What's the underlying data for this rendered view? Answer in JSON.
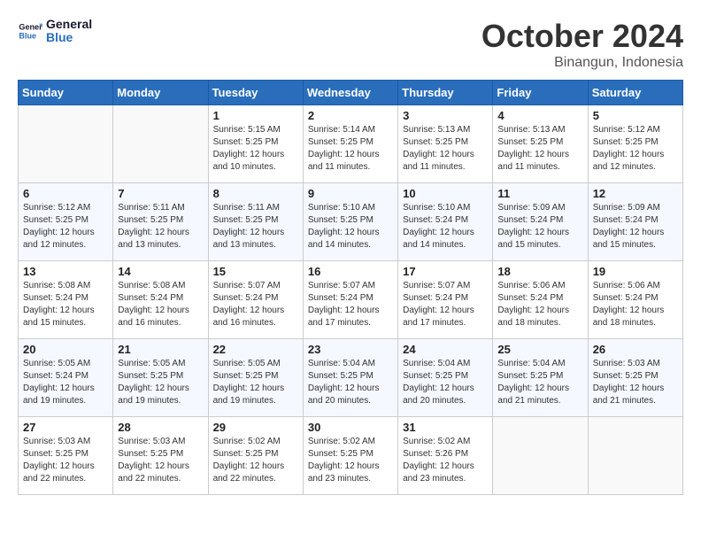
{
  "header": {
    "logo_general": "General",
    "logo_blue": "Blue",
    "month_title": "October 2024",
    "subtitle": "Binangun, Indonesia"
  },
  "days_of_week": [
    "Sunday",
    "Monday",
    "Tuesday",
    "Wednesday",
    "Thursday",
    "Friday",
    "Saturday"
  ],
  "weeks": [
    [
      {
        "day": "",
        "sunrise": "",
        "sunset": "",
        "daylight": "",
        "empty": true
      },
      {
        "day": "",
        "sunrise": "",
        "sunset": "",
        "daylight": "",
        "empty": true
      },
      {
        "day": "1",
        "sunrise": "Sunrise: 5:15 AM",
        "sunset": "Sunset: 5:25 PM",
        "daylight": "Daylight: 12 hours and 10 minutes.",
        "empty": false
      },
      {
        "day": "2",
        "sunrise": "Sunrise: 5:14 AM",
        "sunset": "Sunset: 5:25 PM",
        "daylight": "Daylight: 12 hours and 11 minutes.",
        "empty": false
      },
      {
        "day": "3",
        "sunrise": "Sunrise: 5:13 AM",
        "sunset": "Sunset: 5:25 PM",
        "daylight": "Daylight: 12 hours and 11 minutes.",
        "empty": false
      },
      {
        "day": "4",
        "sunrise": "Sunrise: 5:13 AM",
        "sunset": "Sunset: 5:25 PM",
        "daylight": "Daylight: 12 hours and 11 minutes.",
        "empty": false
      },
      {
        "day": "5",
        "sunrise": "Sunrise: 5:12 AM",
        "sunset": "Sunset: 5:25 PM",
        "daylight": "Daylight: 12 hours and 12 minutes.",
        "empty": false
      }
    ],
    [
      {
        "day": "6",
        "sunrise": "Sunrise: 5:12 AM",
        "sunset": "Sunset: 5:25 PM",
        "daylight": "Daylight: 12 hours and 12 minutes.",
        "empty": false
      },
      {
        "day": "7",
        "sunrise": "Sunrise: 5:11 AM",
        "sunset": "Sunset: 5:25 PM",
        "daylight": "Daylight: 12 hours and 13 minutes.",
        "empty": false
      },
      {
        "day": "8",
        "sunrise": "Sunrise: 5:11 AM",
        "sunset": "Sunset: 5:25 PM",
        "daylight": "Daylight: 12 hours and 13 minutes.",
        "empty": false
      },
      {
        "day": "9",
        "sunrise": "Sunrise: 5:10 AM",
        "sunset": "Sunset: 5:25 PM",
        "daylight": "Daylight: 12 hours and 14 minutes.",
        "empty": false
      },
      {
        "day": "10",
        "sunrise": "Sunrise: 5:10 AM",
        "sunset": "Sunset: 5:24 PM",
        "daylight": "Daylight: 12 hours and 14 minutes.",
        "empty": false
      },
      {
        "day": "11",
        "sunrise": "Sunrise: 5:09 AM",
        "sunset": "Sunset: 5:24 PM",
        "daylight": "Daylight: 12 hours and 15 minutes.",
        "empty": false
      },
      {
        "day": "12",
        "sunrise": "Sunrise: 5:09 AM",
        "sunset": "Sunset: 5:24 PM",
        "daylight": "Daylight: 12 hours and 15 minutes.",
        "empty": false
      }
    ],
    [
      {
        "day": "13",
        "sunrise": "Sunrise: 5:08 AM",
        "sunset": "Sunset: 5:24 PM",
        "daylight": "Daylight: 12 hours and 15 minutes.",
        "empty": false
      },
      {
        "day": "14",
        "sunrise": "Sunrise: 5:08 AM",
        "sunset": "Sunset: 5:24 PM",
        "daylight": "Daylight: 12 hours and 16 minutes.",
        "empty": false
      },
      {
        "day": "15",
        "sunrise": "Sunrise: 5:07 AM",
        "sunset": "Sunset: 5:24 PM",
        "daylight": "Daylight: 12 hours and 16 minutes.",
        "empty": false
      },
      {
        "day": "16",
        "sunrise": "Sunrise: 5:07 AM",
        "sunset": "Sunset: 5:24 PM",
        "daylight": "Daylight: 12 hours and 17 minutes.",
        "empty": false
      },
      {
        "day": "17",
        "sunrise": "Sunrise: 5:07 AM",
        "sunset": "Sunset: 5:24 PM",
        "daylight": "Daylight: 12 hours and 17 minutes.",
        "empty": false
      },
      {
        "day": "18",
        "sunrise": "Sunrise: 5:06 AM",
        "sunset": "Sunset: 5:24 PM",
        "daylight": "Daylight: 12 hours and 18 minutes.",
        "empty": false
      },
      {
        "day": "19",
        "sunrise": "Sunrise: 5:06 AM",
        "sunset": "Sunset: 5:24 PM",
        "daylight": "Daylight: 12 hours and 18 minutes.",
        "empty": false
      }
    ],
    [
      {
        "day": "20",
        "sunrise": "Sunrise: 5:05 AM",
        "sunset": "Sunset: 5:24 PM",
        "daylight": "Daylight: 12 hours and 19 minutes.",
        "empty": false
      },
      {
        "day": "21",
        "sunrise": "Sunrise: 5:05 AM",
        "sunset": "Sunset: 5:25 PM",
        "daylight": "Daylight: 12 hours and 19 minutes.",
        "empty": false
      },
      {
        "day": "22",
        "sunrise": "Sunrise: 5:05 AM",
        "sunset": "Sunset: 5:25 PM",
        "daylight": "Daylight: 12 hours and 19 minutes.",
        "empty": false
      },
      {
        "day": "23",
        "sunrise": "Sunrise: 5:04 AM",
        "sunset": "Sunset: 5:25 PM",
        "daylight": "Daylight: 12 hours and 20 minutes.",
        "empty": false
      },
      {
        "day": "24",
        "sunrise": "Sunrise: 5:04 AM",
        "sunset": "Sunset: 5:25 PM",
        "daylight": "Daylight: 12 hours and 20 minutes.",
        "empty": false
      },
      {
        "day": "25",
        "sunrise": "Sunrise: 5:04 AM",
        "sunset": "Sunset: 5:25 PM",
        "daylight": "Daylight: 12 hours and 21 minutes.",
        "empty": false
      },
      {
        "day": "26",
        "sunrise": "Sunrise: 5:03 AM",
        "sunset": "Sunset: 5:25 PM",
        "daylight": "Daylight: 12 hours and 21 minutes.",
        "empty": false
      }
    ],
    [
      {
        "day": "27",
        "sunrise": "Sunrise: 5:03 AM",
        "sunset": "Sunset: 5:25 PM",
        "daylight": "Daylight: 12 hours and 22 minutes.",
        "empty": false
      },
      {
        "day": "28",
        "sunrise": "Sunrise: 5:03 AM",
        "sunset": "Sunset: 5:25 PM",
        "daylight": "Daylight: 12 hours and 22 minutes.",
        "empty": false
      },
      {
        "day": "29",
        "sunrise": "Sunrise: 5:02 AM",
        "sunset": "Sunset: 5:25 PM",
        "daylight": "Daylight: 12 hours and 22 minutes.",
        "empty": false
      },
      {
        "day": "30",
        "sunrise": "Sunrise: 5:02 AM",
        "sunset": "Sunset: 5:25 PM",
        "daylight": "Daylight: 12 hours and 23 minutes.",
        "empty": false
      },
      {
        "day": "31",
        "sunrise": "Sunrise: 5:02 AM",
        "sunset": "Sunset: 5:26 PM",
        "daylight": "Daylight: 12 hours and 23 minutes.",
        "empty": false
      },
      {
        "day": "",
        "sunrise": "",
        "sunset": "",
        "daylight": "",
        "empty": true
      },
      {
        "day": "",
        "sunrise": "",
        "sunset": "",
        "daylight": "",
        "empty": true
      }
    ]
  ]
}
